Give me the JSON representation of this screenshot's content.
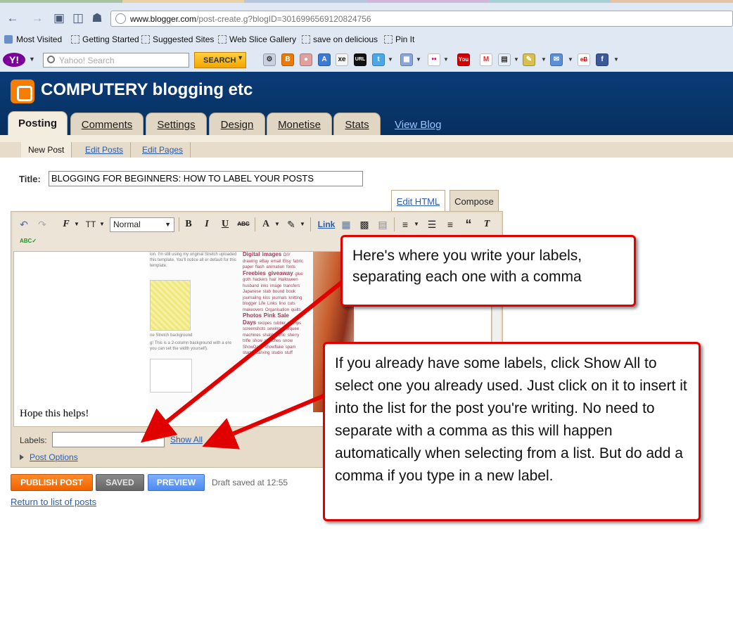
{
  "browser": {
    "url_domain": "www.blogger.com",
    "url_path": "/post-create.g?blogID=3016996569120824756",
    "bookmarks": [
      "Most Visited",
      "Getting Started",
      "Suggested Sites",
      "Web Slice Gallery",
      "save on delicious",
      "Pin It"
    ],
    "yahoo_logo": "Y!",
    "search_placeholder": "Yahoo! Search",
    "search_button": "SEARCH"
  },
  "blog": {
    "title": "COMPUTERY blogging etc",
    "tabs": [
      "Posting",
      "Comments",
      "Settings",
      "Design",
      "Monetise",
      "Stats"
    ],
    "view_blog": "View Blog",
    "subnav": [
      "New Post",
      "Edit Posts",
      "Edit Pages"
    ]
  },
  "editor": {
    "title_label": "Title:",
    "title_value": "BLOGGING FOR BEGINNERS: HOW TO LABEL YOUR POSTS",
    "mode_html": "Edit HTML",
    "mode_compose": "Compose",
    "font_size": "Normal",
    "link_label": "Link",
    "body_text": "Hope this helps!",
    "labels_label": "Labels:",
    "labels_value": "",
    "show_all": "Show All",
    "post_options": "Post Options"
  },
  "actions": {
    "publish": "PUBLISH POST",
    "saved": "SAVED",
    "preview": "PREVIEW",
    "draft_status": "Draft saved at 12:55",
    "return_link": "Return to list of posts"
  },
  "annotations": {
    "labels_tip": "Here's where you write your labels, separating each one with a comma",
    "show_all_tip": "If you already have some labels, click Show All to select one you already used. Just click on it to insert it into the list for the post you're writing. No need to separate with a comma as this will happen automatically when selecting from a list. But do add a comma if you type in a new label."
  },
  "colors": {
    "blogger_header": "#0a3b77",
    "tab_bg": "#e0d6c3",
    "callout_border": "#e10000",
    "publish": "#f06300",
    "preview": "#4d8af0"
  }
}
